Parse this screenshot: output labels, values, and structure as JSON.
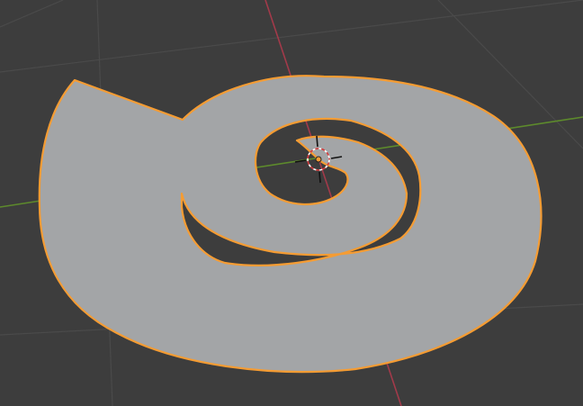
{
  "viewport": {
    "kind": "3d-viewport",
    "background_color": "#3d3d3d",
    "grid_color": "#4a4a4a",
    "x_axis_color": "#a23a4a",
    "y_axis_color": "#5d8a2c",
    "object": {
      "shape": "spiral-plane",
      "selected": true,
      "face_color": "#a3a5a7",
      "outline_color": "#f59c33"
    },
    "origin_color": "#f59c33",
    "cursor_icon": "3d-cursor-icon"
  }
}
